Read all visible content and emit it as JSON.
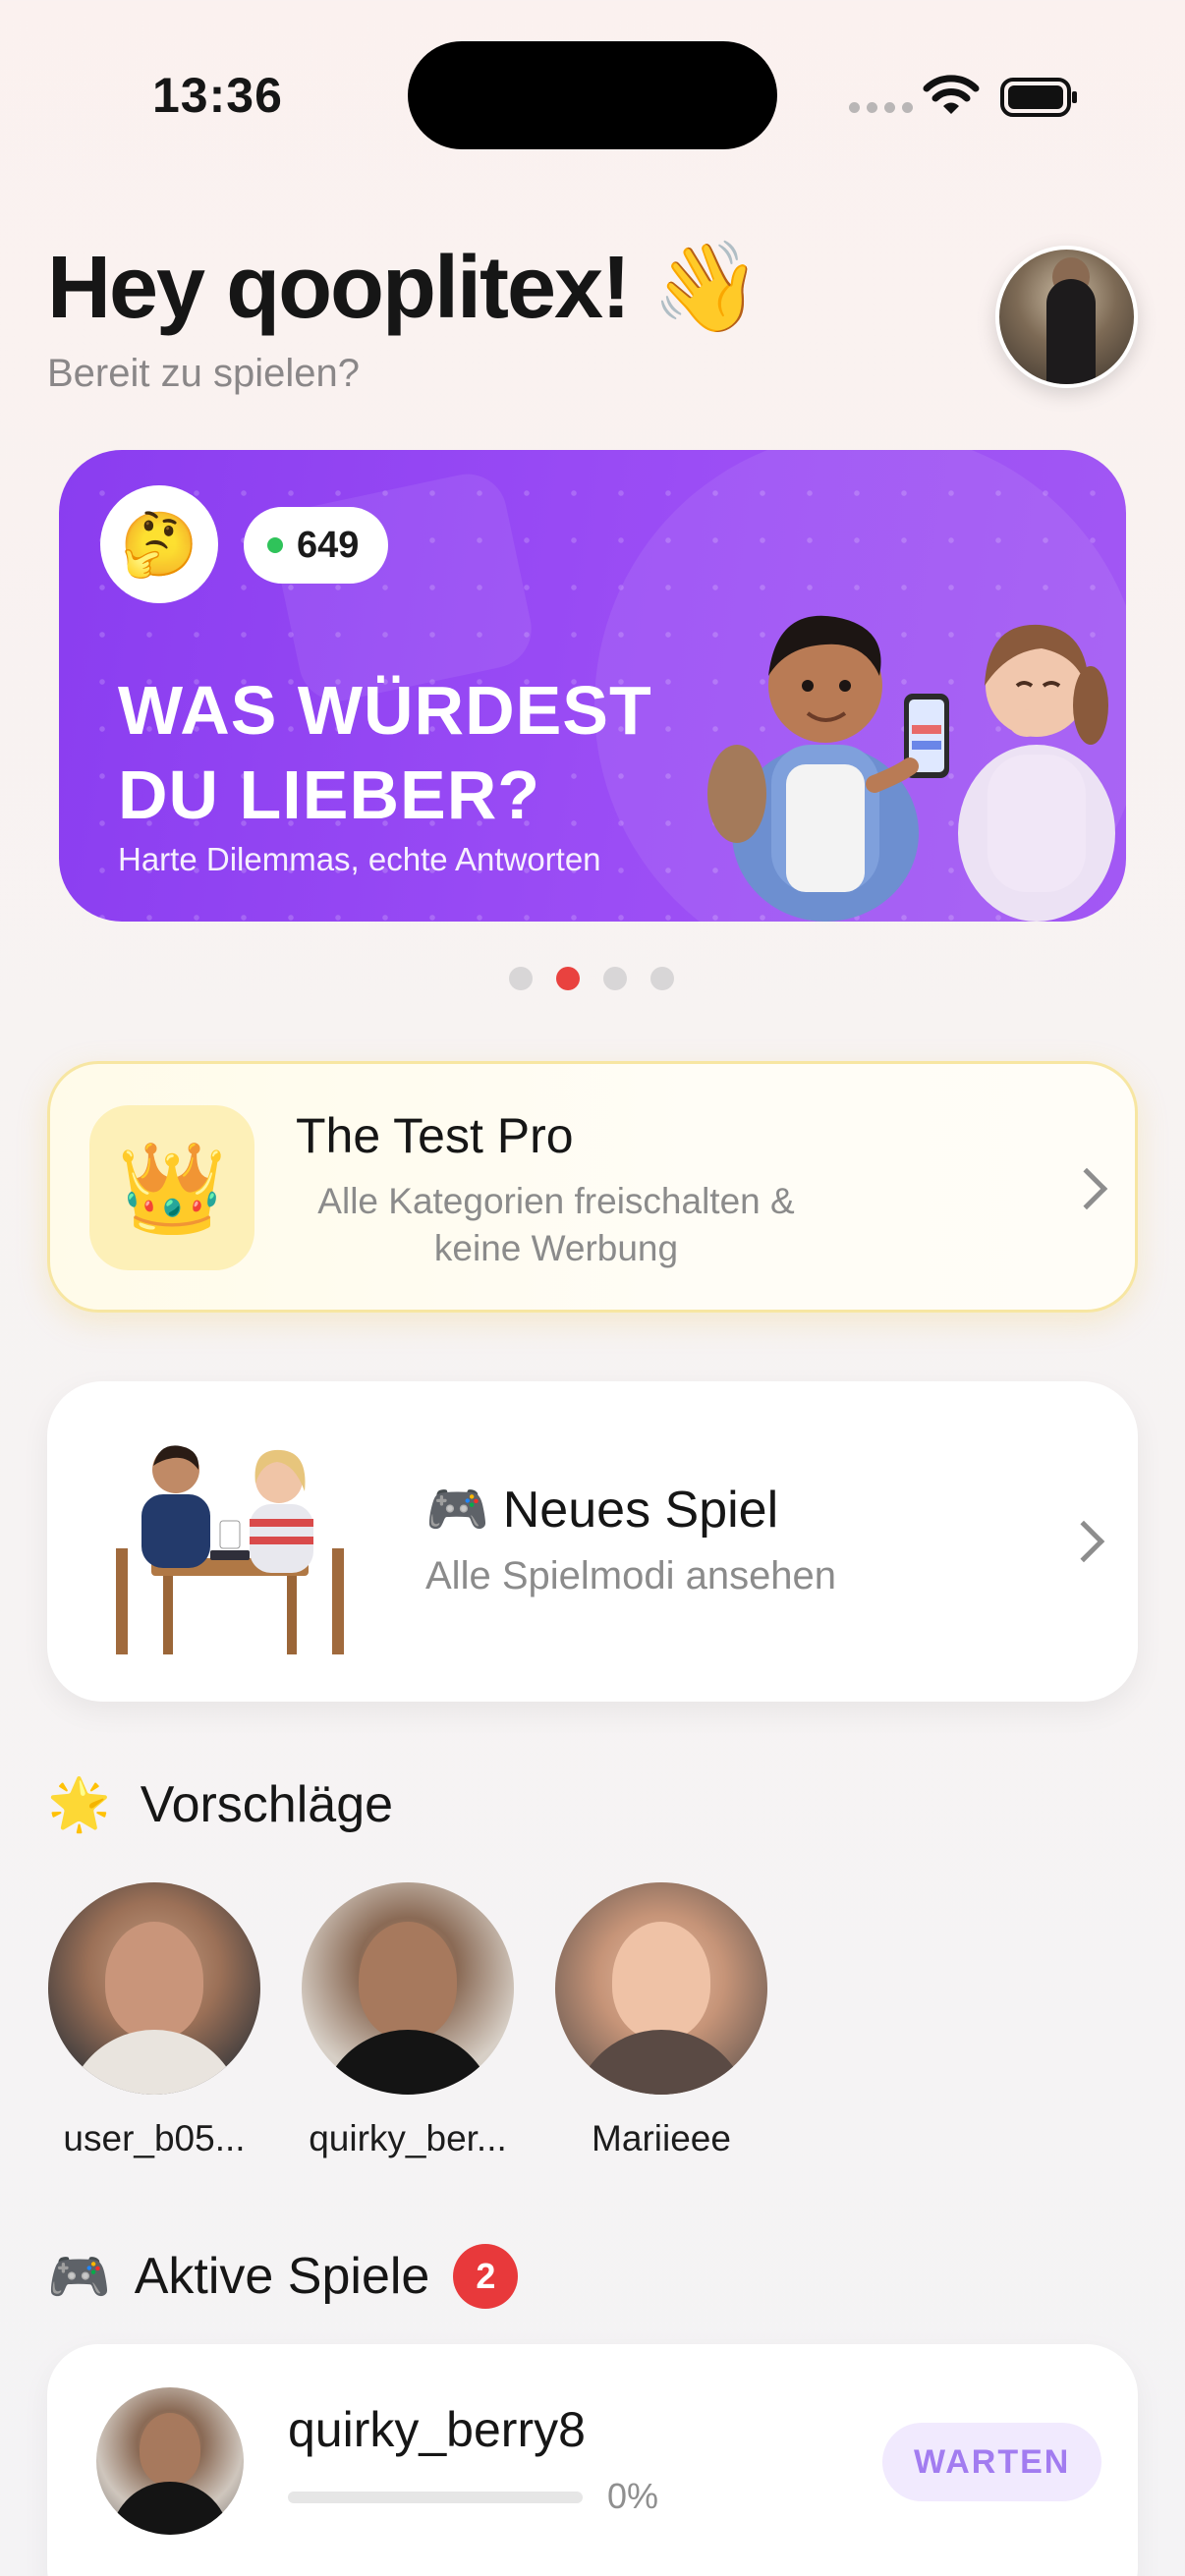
{
  "status_bar": {
    "time": "13:36"
  },
  "header": {
    "greeting": "Hey qooplitex! 👋",
    "subtitle": "Bereit zu spielen?"
  },
  "hero": {
    "emoji": "🤔",
    "live_count": "649",
    "title": "WAS WÜRDEST DU LIEBER?",
    "subtitle": "Harte Dilemmas, echte Antworten",
    "pager": {
      "total": 4,
      "active_index": 1
    }
  },
  "pro": {
    "icon": "👑",
    "title": "The Test Pro",
    "description": "Alle Kategorien freischalten & keine Werbung"
  },
  "new_game": {
    "icon": "🎮",
    "title": "Neues Spiel",
    "subtitle": "Alle Spielmodi ansehen"
  },
  "suggestions": {
    "icon": "🌟",
    "title": "Vorschläge",
    "items": [
      {
        "name": "user_b05..."
      },
      {
        "name": "quirky_ber..."
      },
      {
        "name": "Mariieee"
      }
    ]
  },
  "active_games": {
    "icon": "🎮",
    "title": "Aktive Spiele",
    "count": "2",
    "items": [
      {
        "name": "quirky_berry8",
        "progress_text": "0%",
        "progress": 0,
        "status": "WARTEN"
      }
    ]
  },
  "colors": {
    "accent_purple": "#9b4df5",
    "badge_red": "#e8393b",
    "live_green": "#2fc35a",
    "pro_background": "#fffbe9"
  }
}
